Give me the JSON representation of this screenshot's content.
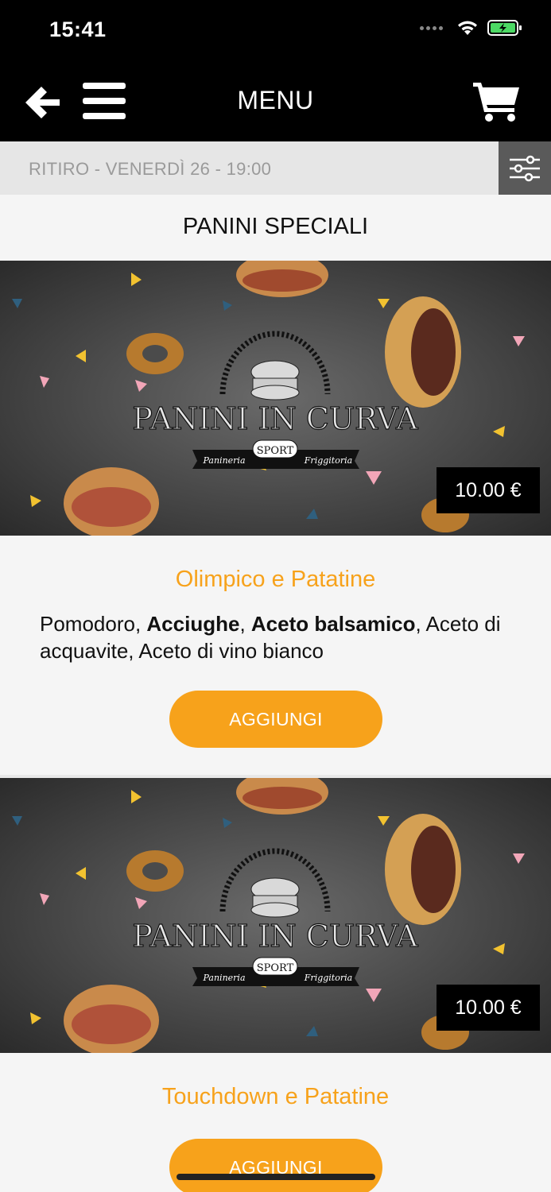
{
  "status_bar": {
    "time": "15:41"
  },
  "navbar": {
    "title": "MENU"
  },
  "pickup": {
    "text": "RITIRO - VENERDÌ 26 - 19:00"
  },
  "section": {
    "title": "PANINI SPECIALI"
  },
  "logo": {
    "line1": "PANINI IN CURVA",
    "left": "Panineria",
    "center": "SPORT",
    "right": "Friggitoria"
  },
  "products": [
    {
      "price": "10.00 €",
      "name": "Olimpico e Patatine",
      "desc_parts": [
        {
          "text": "Pomodoro, ",
          "bold": false
        },
        {
          "text": "Acciughe",
          "bold": true
        },
        {
          "text": ", ",
          "bold": false
        },
        {
          "text": "Aceto balsamico",
          "bold": true
        },
        {
          "text": ", Aceto di acquavite, Aceto di vino bianco",
          "bold": false
        }
      ],
      "button": "AGGIUNGI"
    },
    {
      "price": "10.00 €",
      "name": "Touchdown e Patatine",
      "button": "AGGIUNGI"
    }
  ],
  "colors": {
    "accent": "#f7a21b",
    "navbar": "#000000",
    "pickup_bg": "#e6e6e6",
    "filter_bg": "#5a5a5a"
  },
  "icons": [
    "back-arrow-icon",
    "hamburger-menu-icon",
    "cart-icon",
    "filter-sliders-icon",
    "wifi-icon",
    "battery-icon"
  ]
}
